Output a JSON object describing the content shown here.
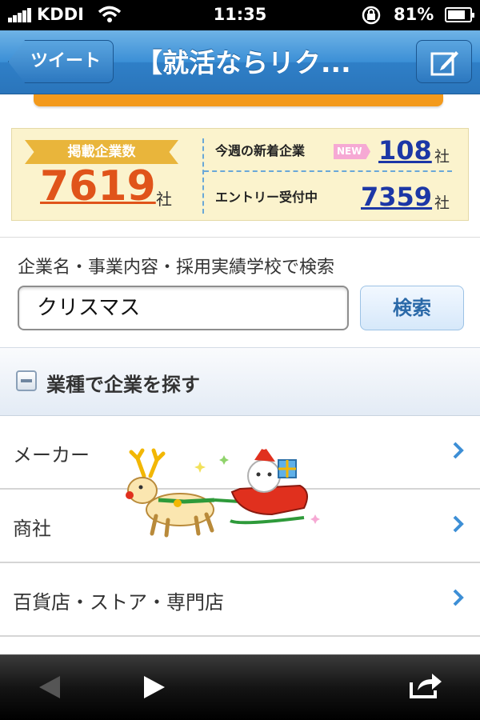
{
  "status_bar": {
    "carrier": "KDDI",
    "time": "11:35",
    "battery_percent": "81%",
    "battery_level": 0.81
  },
  "nav": {
    "back_label": "ツイート",
    "title": "【就活ならリク..."
  },
  "stats": {
    "total_label": "掲載企業数",
    "total_count": "7619",
    "unit": "社",
    "new_label": "今週の新着企業",
    "new_badge": "NEW",
    "new_count": "108",
    "entry_label": "エントリー受付中",
    "entry_count": "7359"
  },
  "search": {
    "caption": "企業名・事業内容・採用実績学校で検索",
    "value": "クリスマス",
    "button_label": "検索"
  },
  "section": {
    "title": "業種で企業を探す"
  },
  "industries": [
    {
      "label": "メーカー"
    },
    {
      "label": "商社"
    },
    {
      "label": "百貨店・ストア・専門店"
    }
  ],
  "colors": {
    "nav_blue": "#2f7fc7",
    "accent_orange": "#f39a1c",
    "count_orange": "#e0541a",
    "link_blue": "#1c37a6",
    "stats_bg": "#fbf3cd"
  },
  "icons": {
    "wifi": "wifi-icon",
    "lock": "rotation-lock-icon",
    "compose": "compose-icon",
    "chevron": "chevron-right-icon",
    "back": "back-arrow-icon",
    "forward": "forward-arrow-icon",
    "share": "share-icon"
  }
}
